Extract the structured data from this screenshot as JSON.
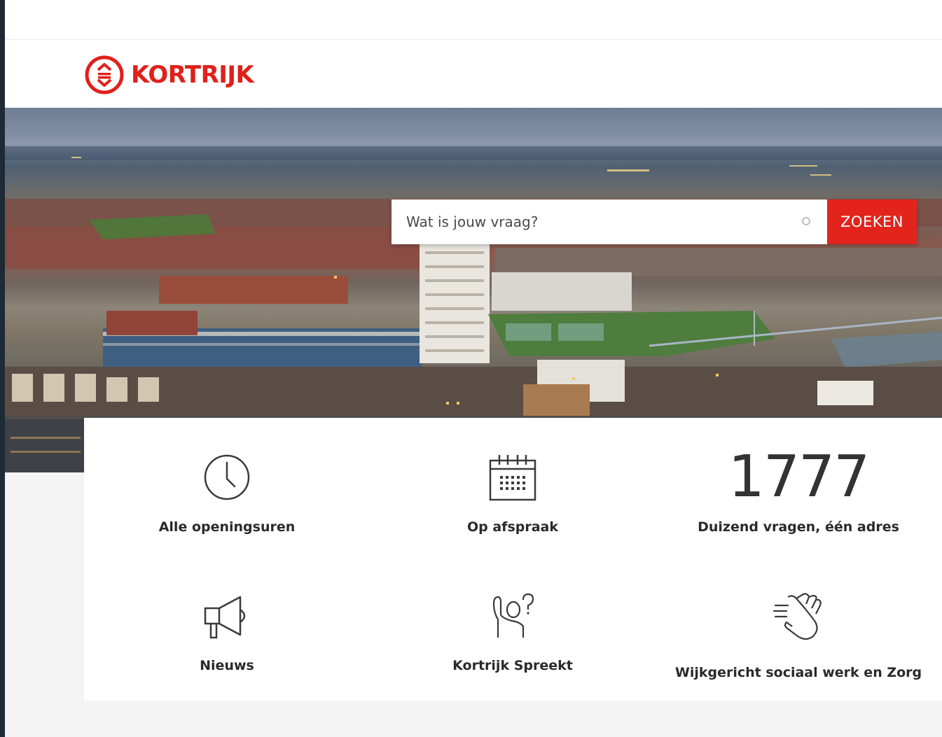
{
  "brand": {
    "name": "KORTRIJK",
    "color": "#e0201b"
  },
  "search": {
    "placeholder": "Wat is jouw vraag?",
    "button_label": "ZOEKEN",
    "button_color": "#e3241c"
  },
  "tiles": [
    {
      "label": "Alle openingsuren",
      "icon": "clock-icon"
    },
    {
      "label": "Op afspraak",
      "icon": "calendar-icon"
    },
    {
      "label": "Duizend vragen, één adres",
      "number": "1777"
    },
    {
      "label": "Nieuws",
      "icon": "megaphone-icon"
    },
    {
      "label": "Kortrijk Spreekt",
      "icon": "speech-hand-icon"
    },
    {
      "label": "Wijkgericht sociaal werk en Zorg",
      "icon": "clapping-hands-icon"
    }
  ]
}
